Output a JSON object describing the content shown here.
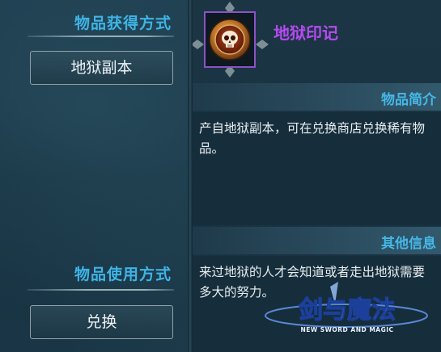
{
  "left": {
    "acquire_title": "物品获得方式",
    "acquire_button": "地狱副本",
    "use_title": "物品使用方式",
    "use_button": "兑换"
  },
  "item": {
    "name": "地狱印记",
    "icon": "skull-medallion-icon",
    "name_color": "#b44bf0",
    "frame_color": "#8b52c6"
  },
  "intro": {
    "title": "物品简介",
    "text": "产自地狱副本，可在兑换商店兑换稀有物品。"
  },
  "other": {
    "title": "其他信息",
    "text": "来过地狱的人才会知道或者走出地狱需要多大的努力。"
  },
  "logo": {
    "title": "剑与魔法",
    "subtitle": "NEW SWORD AND MAGIC"
  },
  "colors": {
    "accent": "#3fb4e6",
    "text": "#e8eef0"
  }
}
